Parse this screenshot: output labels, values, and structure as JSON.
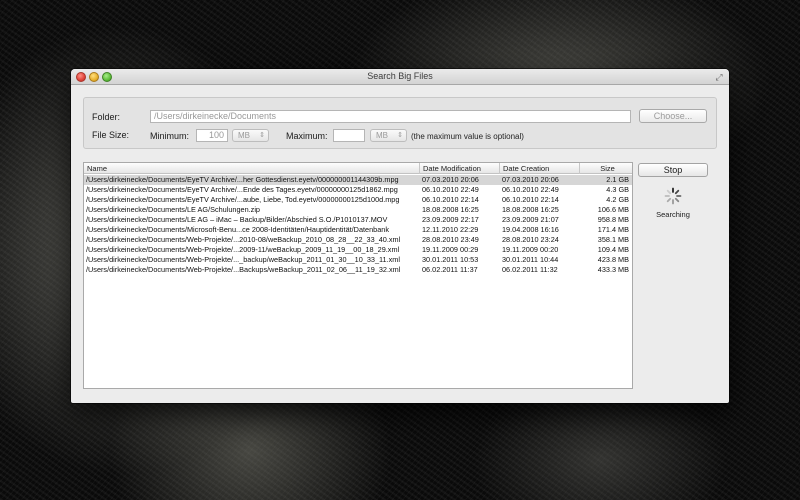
{
  "window": {
    "title": "Search Big Files"
  },
  "form": {
    "folder_label": "Folder:",
    "folder_value": "/Users/dirkeinecke/Documents",
    "choose_button": "Choose...",
    "file_size_label": "File Size:",
    "minimum_label": "Minimum:",
    "minimum_value": "100",
    "minimum_unit": "MB",
    "maximum_label": "Maximum:",
    "maximum_value": "",
    "maximum_unit": "MB",
    "maximum_hint": "(the maximum value is optional)"
  },
  "table": {
    "columns": [
      "Name",
      "Date Modification",
      "Date Creation",
      "Size"
    ],
    "rows": [
      [
        "/Users/dirkeinecke/Documents/EyeTV Archive/...her Gottesdienst.eyetv/000000001144309b.mpg",
        "07.03.2010 20:06",
        "07.03.2010 20:06",
        "2.1 GB"
      ],
      [
        "/Users/dirkeinecke/Documents/EyeTV Archive/...Ende des Tages.eyetv/00000000125d1862.mpg",
        "06.10.2010 22:49",
        "06.10.2010 22:49",
        "4.3 GB"
      ],
      [
        "/Users/dirkeinecke/Documents/EyeTV Archive/...aube, Liebe, Tod.eyetv/00000000125d100d.mpg",
        "06.10.2010 22:14",
        "06.10.2010 22:14",
        "4.2 GB"
      ],
      [
        "/Users/dirkeinecke/Documents/LE AG/Schulungen.zip",
        "18.08.2008 16:25",
        "18.08.2008 16:25",
        "106.6 MB"
      ],
      [
        "/Users/dirkeinecke/Documents/LE AG – iMac – Backup/Bilder/Abschied S.O./P1010137.MOV",
        "23.09.2009 22:17",
        "23.09.2009 21:07",
        "958.8 MB"
      ],
      [
        "/Users/dirkeinecke/Documents/Microsoft-Benu...ce 2008-Identitäten/Hauptidentität/Datenbank",
        "12.11.2010 22:29",
        "19.04.2008 16:16",
        "171.4 MB"
      ],
      [
        "/Users/dirkeinecke/Documents/Web-Projekte/...2010-08/weBackup_2010_08_28__22_33_40.xml",
        "28.08.2010 23:49",
        "28.08.2010 23:24",
        "358.1 MB"
      ],
      [
        "/Users/dirkeinecke/Documents/Web-Projekte/...2009-11/weBackup_2009_11_19__00_18_29.xml",
        "19.11.2009 00:29",
        "19.11.2009 00:20",
        "109.4 MB"
      ],
      [
        "/Users/dirkeinecke/Documents/Web-Projekte/..._backup/weBackup_2011_01_30__10_33_11.xml",
        "30.01.2011 10:53",
        "30.01.2011 10:44",
        "423.8 MB"
      ],
      [
        "/Users/dirkeinecke/Documents/Web-Projekte/...Backups/weBackup_2011_02_06__11_19_32.xml",
        "06.02.2011 11:37",
        "06.02.2011 11:32",
        "433.3 MB"
      ]
    ],
    "selected_index": 0
  },
  "actions": {
    "stop_button": "Stop",
    "status_text": "Searching"
  },
  "icons": {
    "close": "close-button",
    "minimize": "minimize-button",
    "zoom": "zoom-button",
    "fullscreen": "fullscreen-icon",
    "spinner": "spinner-icon"
  },
  "colors": {
    "selection": "#d6d6d6",
    "window_bg": "#ececec"
  }
}
